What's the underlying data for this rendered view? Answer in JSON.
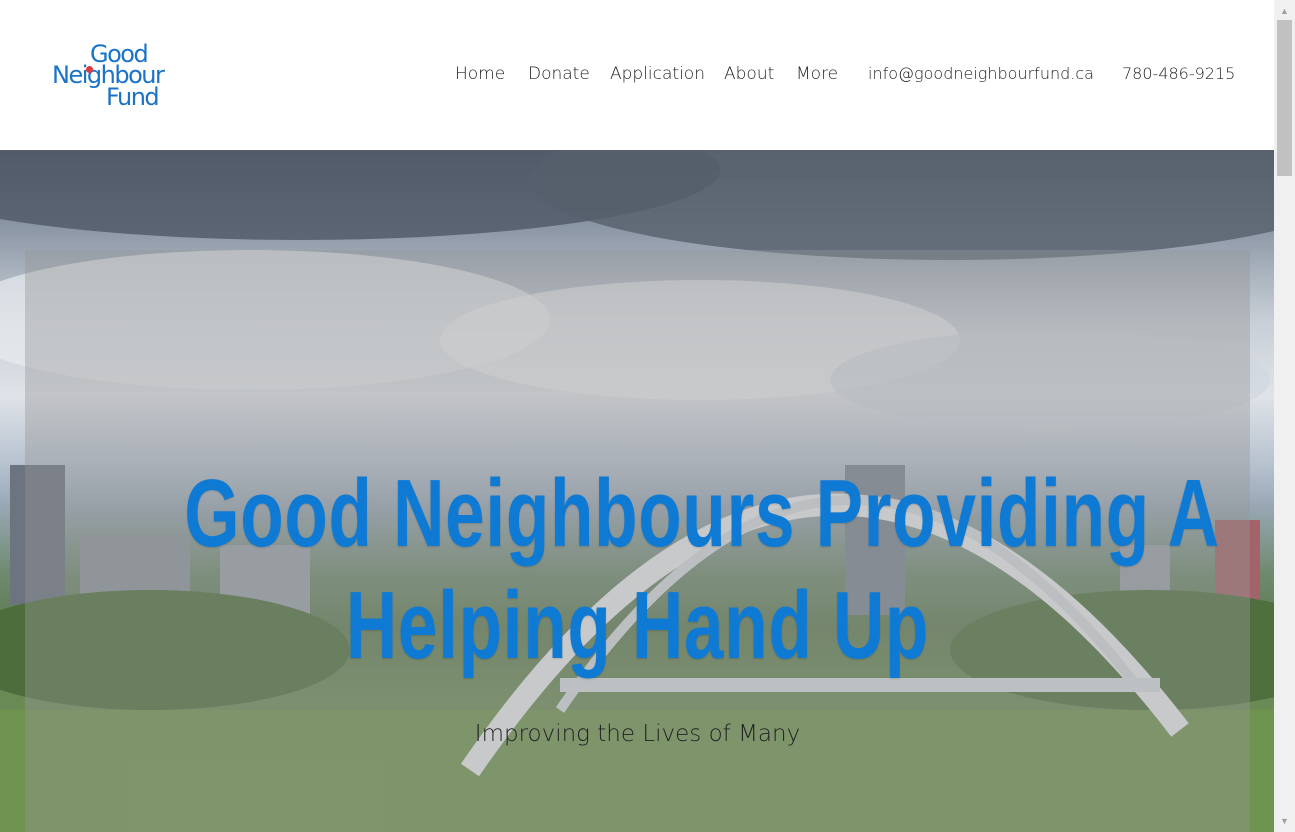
{
  "logo": {
    "line1": "Good",
    "line2": "Neighbour",
    "line3": "Fund"
  },
  "nav": {
    "items": [
      "Home",
      "Donate",
      "Application",
      "About",
      "More"
    ],
    "email": "info@goodneighbourfund.ca",
    "phone": "780-486-9215"
  },
  "hero": {
    "headline_line1": "Good Neighbours Providing A",
    "headline_line2": "Helping Hand Up",
    "tagline": "Improving the Lives of Many"
  },
  "colors": {
    "brand_blue": "#1a73c7",
    "headline_blue": "#0e7ad4",
    "logo_dot_red": "#e03a3e"
  },
  "icons": {
    "scroll_up": "triangle-up-icon",
    "scroll_down": "triangle-down-icon"
  }
}
